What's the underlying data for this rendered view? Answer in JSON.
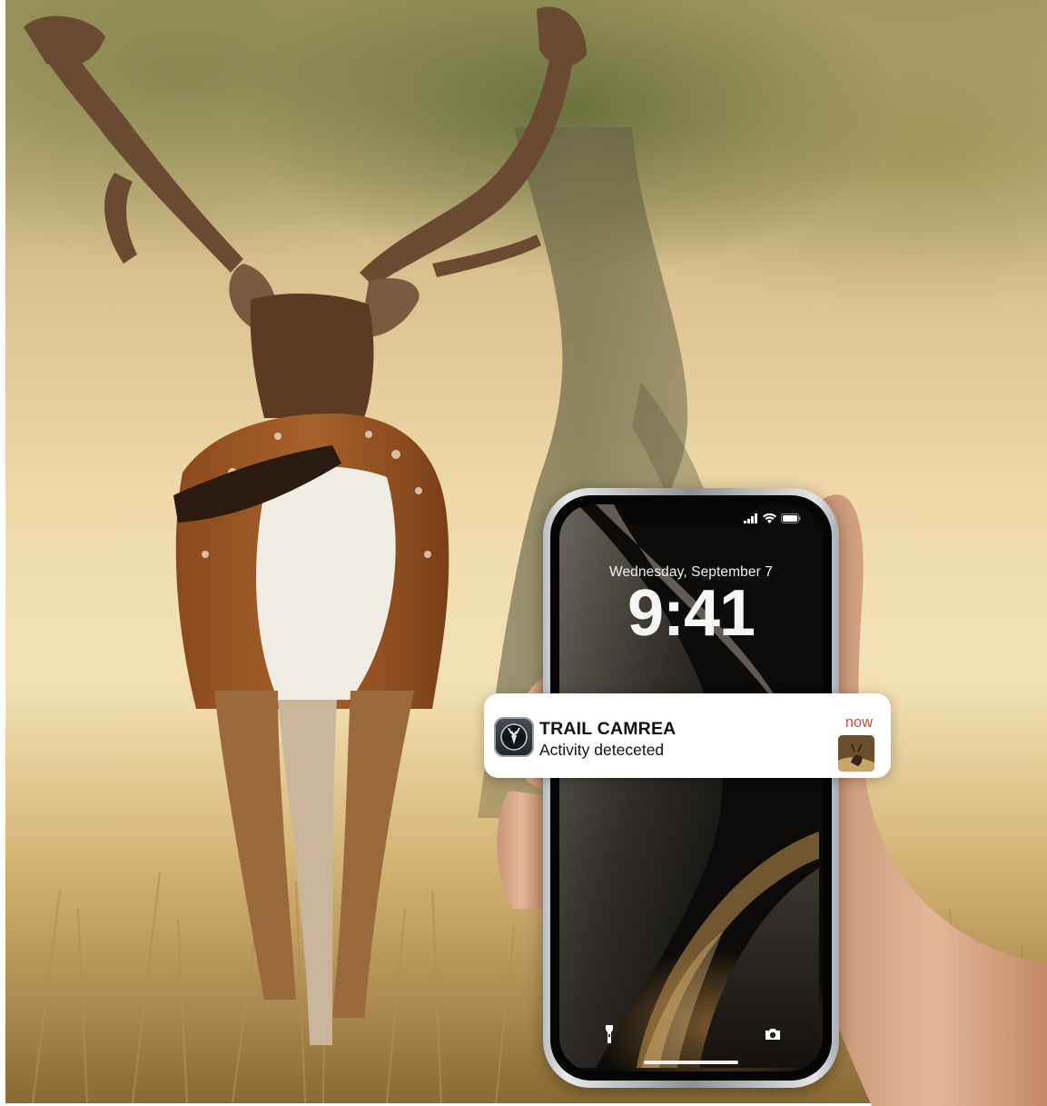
{
  "phone": {
    "lock_screen": {
      "date": "Wednesday, September 7",
      "time": "9:41",
      "status_icons": [
        "signal-icon",
        "wifi-icon",
        "battery-icon"
      ],
      "bottom_icons": [
        "flashlight-icon",
        "camera-icon"
      ]
    }
  },
  "notification": {
    "app_name": "TRAIL CAMREA",
    "message": "Activity deteceted",
    "time": "now",
    "app_icon": "deer-logo-icon",
    "accent_color": "#e0452e"
  }
}
